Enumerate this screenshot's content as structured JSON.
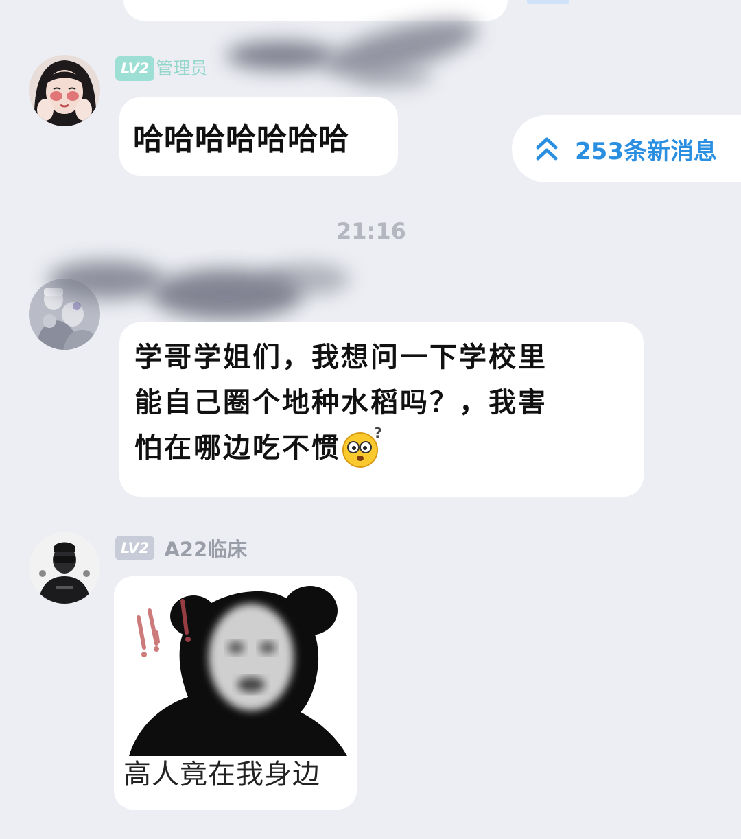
{
  "messages": [
    {
      "level_badge": "LV2",
      "role_tag": "管理员",
      "text": "哈哈哈哈哈哈哈"
    },
    {
      "text_lines": [
        "学哥学姐们，我想问一下学校里",
        "能自己圈个地种水稻吗？，我害",
        "怕在哪边吃不惯"
      ],
      "emoji_icon": "confused-face-emoji"
    },
    {
      "level_badge": "LV2",
      "sender_name": "A22临床",
      "sticker_caption": "高人竟在我身边",
      "sticker_icon": "panda-meme-sticker"
    }
  ],
  "new_messages_label": "253条新消息",
  "new_messages_icon": "double-chevron-up-icon",
  "timestamp": "21:16",
  "colors": {
    "background": "#eceef3",
    "accent": "#2a8fe0",
    "admin_badge": "#9ddfd4",
    "plain_badge": "#c8ccd8"
  }
}
